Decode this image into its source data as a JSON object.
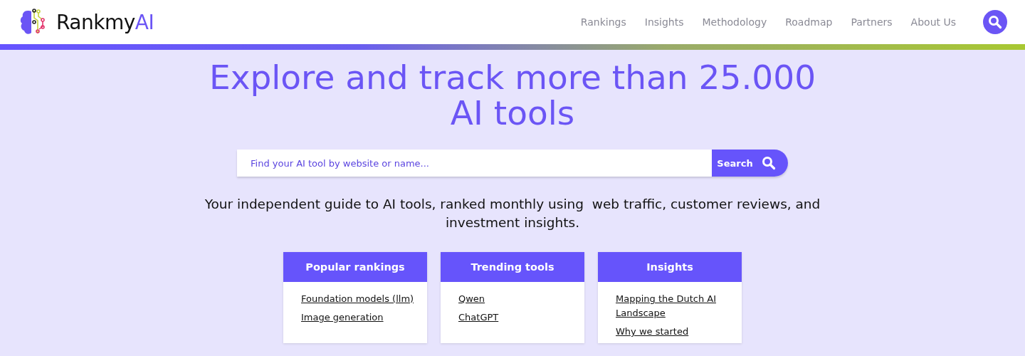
{
  "logo": {
    "text_main": "Rankmy",
    "text_accent": "AI"
  },
  "nav": {
    "items": [
      "Rankings",
      "Insights",
      "Methodology",
      "Roadmap",
      "Partners",
      "About Us"
    ]
  },
  "hero": {
    "title": "Explore and track more than 25.000 AI tools",
    "search": {
      "placeholder": "Find your AI tool by website or name...",
      "button": "Search"
    },
    "subtitle": "Your independent guide to AI tools, ranked monthly using  web traffic, customer reviews, and investment insights."
  },
  "cards": [
    {
      "title": "Popular rankings",
      "links": [
        "Foundation models (llm)",
        "Image generation"
      ]
    },
    {
      "title": "Trending tools",
      "links": [
        "Qwen",
        "ChatGPT"
      ]
    },
    {
      "title": "Insights",
      "links": [
        "Mapping the Dutch AI Landscape",
        "Why we started"
      ]
    }
  ]
}
